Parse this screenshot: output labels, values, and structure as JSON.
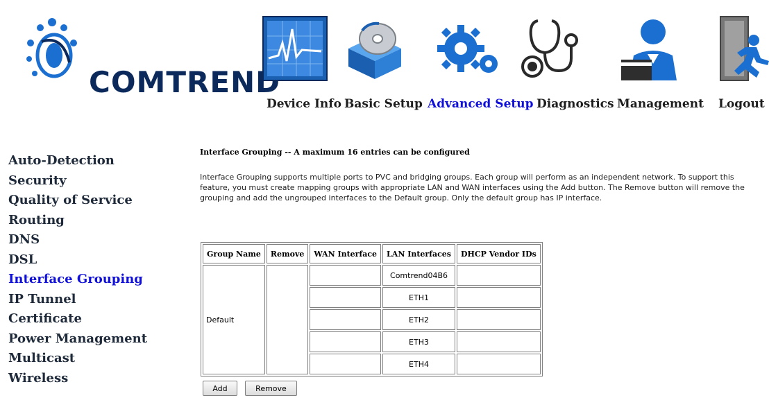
{
  "brand": {
    "name": "COMTREND"
  },
  "nav": [
    {
      "label": "Device Info",
      "icon": "device-info-icon"
    },
    {
      "label": "Basic Setup",
      "icon": "basic-setup-icon"
    },
    {
      "label": "Advanced Setup",
      "icon": "advanced-setup-icon",
      "active": true
    },
    {
      "label": "Diagnostics",
      "icon": "diagnostics-icon"
    },
    {
      "label": "Management",
      "icon": "management-icon"
    },
    {
      "label": "Logout",
      "icon": "logout-icon"
    }
  ],
  "sidebar": {
    "items": [
      {
        "label": "Auto-Detection"
      },
      {
        "label": "Security"
      },
      {
        "label": "Quality of Service"
      },
      {
        "label": "Routing"
      },
      {
        "label": "DNS"
      },
      {
        "label": "DSL"
      },
      {
        "label": "Interface Grouping",
        "active": true
      },
      {
        "label": "IP Tunnel"
      },
      {
        "label": "Certificate"
      },
      {
        "label": "Power Management"
      },
      {
        "label": "Multicast"
      },
      {
        "label": "Wireless"
      }
    ]
  },
  "main": {
    "title": "Interface Grouping -- A maximum 16 entries can be configured",
    "description": "Interface Grouping supports multiple ports to PVC and bridging groups. Each group will perform as an independent network. To support this feature, you must create mapping groups with appropriate LAN and WAN interfaces using the Add button. The Remove button will remove the grouping and add the ungrouped interfaces to the Default group. Only the default group has IP interface.",
    "table": {
      "headers": [
        "Group Name",
        "Remove",
        "WAN Interface",
        "LAN Interfaces",
        "DHCP Vendor IDs"
      ],
      "group_name": "Default",
      "lan_interfaces": [
        "Comtrend04B6",
        "ETH1",
        "ETH2",
        "ETH3",
        "ETH4"
      ]
    },
    "buttons": {
      "add": "Add",
      "remove": "Remove"
    }
  },
  "colors": {
    "active_link": "#1010d8",
    "logo_blue": "#0b2a5b",
    "icon_blue": "#1a6fd0"
  }
}
